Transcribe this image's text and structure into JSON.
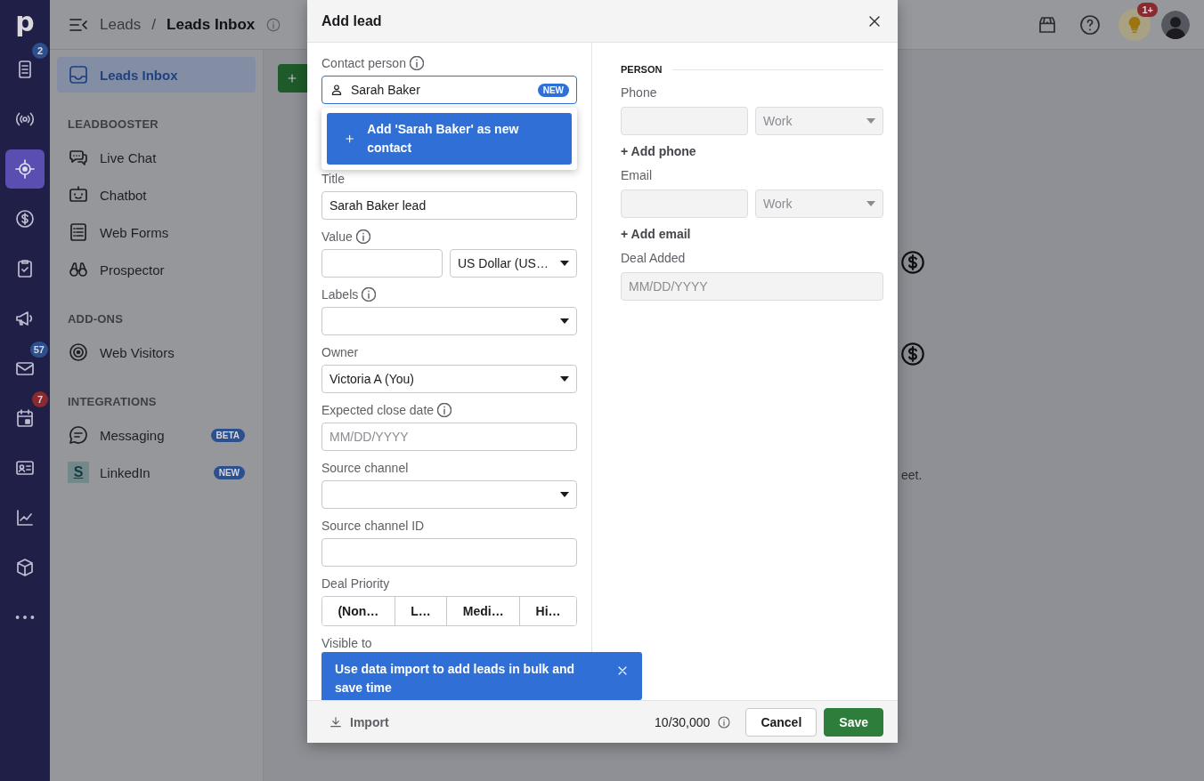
{
  "rail": {
    "logo": "p",
    "items": [
      {
        "selected": false,
        "badge": "2",
        "color": "#2c4f8e"
      },
      {
        "selected": false
      },
      {
        "selected": true
      },
      {
        "selected": false
      },
      {
        "selected": false
      },
      {
        "selected": false
      },
      {
        "selected": false,
        "badge": "57",
        "color": "#2c4f8e"
      },
      {
        "selected": false,
        "badge": "7",
        "color": "#8a2a2e"
      },
      {
        "selected": false
      },
      {
        "selected": false
      },
      {
        "selected": false
      },
      {
        "selected": false
      }
    ]
  },
  "topbar": {
    "breadcrumb": [
      "Leads",
      "Leads Inbox"
    ],
    "separator": "/",
    "notification_badge": "1+"
  },
  "sidebar": {
    "items": [
      {
        "label": "Leads Inbox",
        "selected": true
      }
    ],
    "sections": [
      {
        "heading": "LEADBOOSTER",
        "items": [
          {
            "label": "Live Chat",
            "selected": false
          },
          {
            "label": "Chatbot",
            "selected": false
          },
          {
            "label": "Web Forms",
            "selected": false
          },
          {
            "label": "Prospector",
            "selected": false
          }
        ]
      },
      {
        "heading": "ADD-ONS",
        "items": [
          {
            "label": "Web Visitors",
            "selected": false
          }
        ]
      },
      {
        "heading": "INTEGRATIONS",
        "items": [
          {
            "label": "Messaging",
            "selected": false,
            "badge": "BETA"
          },
          {
            "label": "LinkedIn",
            "selected": false,
            "badge": "NEW",
            "logo": "S"
          }
        ]
      }
    ]
  },
  "background": {
    "text_fragment": "eet."
  },
  "modal": {
    "title": "Add lead",
    "fields": [
      {
        "kind": "contact",
        "label": "Contact person",
        "info": true,
        "value": "Sarah Baker",
        "badge": "NEW",
        "suggestion": "Add 'Sarah Baker' as new contact"
      },
      {
        "kind": "text",
        "label": "Title",
        "info": false,
        "value": "Sarah Baker lead"
      },
      {
        "kind": "money",
        "label": "Value",
        "info": true,
        "currency": "US Dollar (US…"
      },
      {
        "kind": "select",
        "label": "Labels",
        "info": true
      },
      {
        "kind": "select",
        "label": "Owner",
        "info": false,
        "value": "Victoria A (You)"
      },
      {
        "kind": "text",
        "label": "Expected close date",
        "info": true,
        "placeholder": "MM/DD/YYYY"
      },
      {
        "kind": "select",
        "label": "Source channel",
        "info": false
      },
      {
        "kind": "text",
        "label": "Source channel ID",
        "info": false
      },
      {
        "kind": "segmented",
        "label": "Deal Priority",
        "info": false,
        "options": [
          {
            "label": "(Non…",
            "selected": false
          },
          {
            "label": "L…",
            "selected": false
          },
          {
            "label": "Medi…",
            "selected": false
          },
          {
            "label": "Hi…",
            "selected": false
          }
        ]
      },
      {
        "kind": "label",
        "label": "Visible to",
        "info": false
      }
    ],
    "person": {
      "heading": "PERSON",
      "groups": [
        {
          "kind": "typed",
          "label": "Phone",
          "type": "Work",
          "add": "+ Add phone",
          "disabled": true
        },
        {
          "kind": "typed",
          "label": "Email",
          "type": "Work",
          "add": "+ Add email",
          "disabled": true
        },
        {
          "kind": "date",
          "label": "Deal Added",
          "placeholder": "MM/DD/YYYY",
          "disabled": true
        }
      ]
    },
    "tooltip": "Use data import to add leads in bulk and save time",
    "footer": {
      "import": "Import",
      "counter": "10/30,000",
      "cancel": "Cancel",
      "save": "Save"
    }
  }
}
